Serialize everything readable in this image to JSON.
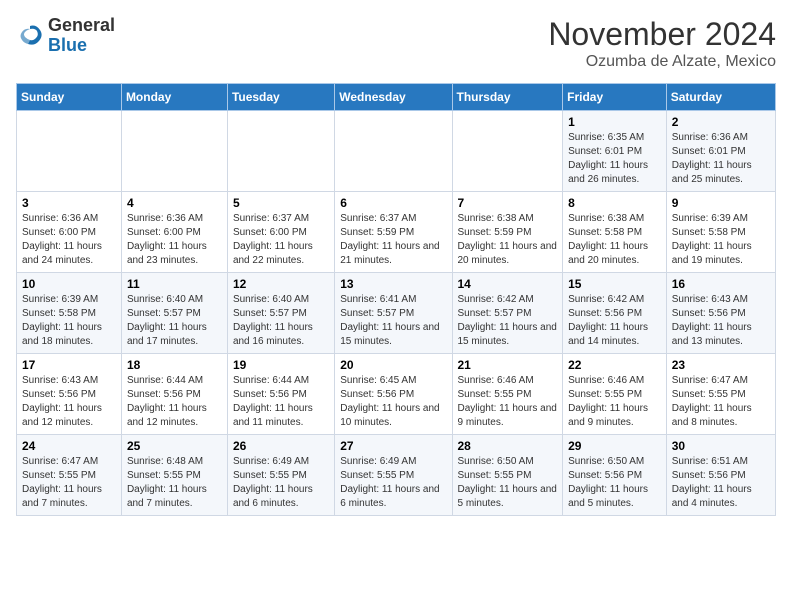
{
  "logo": {
    "general": "General",
    "blue": "Blue"
  },
  "title": "November 2024",
  "subtitle": "Ozumba de Alzate, Mexico",
  "headers": [
    "Sunday",
    "Monday",
    "Tuesday",
    "Wednesday",
    "Thursday",
    "Friday",
    "Saturday"
  ],
  "weeks": [
    [
      {
        "day": "",
        "info": ""
      },
      {
        "day": "",
        "info": ""
      },
      {
        "day": "",
        "info": ""
      },
      {
        "day": "",
        "info": ""
      },
      {
        "day": "",
        "info": ""
      },
      {
        "day": "1",
        "info": "Sunrise: 6:35 AM\nSunset: 6:01 PM\nDaylight: 11 hours and 26 minutes."
      },
      {
        "day": "2",
        "info": "Sunrise: 6:36 AM\nSunset: 6:01 PM\nDaylight: 11 hours and 25 minutes."
      }
    ],
    [
      {
        "day": "3",
        "info": "Sunrise: 6:36 AM\nSunset: 6:00 PM\nDaylight: 11 hours and 24 minutes."
      },
      {
        "day": "4",
        "info": "Sunrise: 6:36 AM\nSunset: 6:00 PM\nDaylight: 11 hours and 23 minutes."
      },
      {
        "day": "5",
        "info": "Sunrise: 6:37 AM\nSunset: 6:00 PM\nDaylight: 11 hours and 22 minutes."
      },
      {
        "day": "6",
        "info": "Sunrise: 6:37 AM\nSunset: 5:59 PM\nDaylight: 11 hours and 21 minutes."
      },
      {
        "day": "7",
        "info": "Sunrise: 6:38 AM\nSunset: 5:59 PM\nDaylight: 11 hours and 20 minutes."
      },
      {
        "day": "8",
        "info": "Sunrise: 6:38 AM\nSunset: 5:58 PM\nDaylight: 11 hours and 20 minutes."
      },
      {
        "day": "9",
        "info": "Sunrise: 6:39 AM\nSunset: 5:58 PM\nDaylight: 11 hours and 19 minutes."
      }
    ],
    [
      {
        "day": "10",
        "info": "Sunrise: 6:39 AM\nSunset: 5:58 PM\nDaylight: 11 hours and 18 minutes."
      },
      {
        "day": "11",
        "info": "Sunrise: 6:40 AM\nSunset: 5:57 PM\nDaylight: 11 hours and 17 minutes."
      },
      {
        "day": "12",
        "info": "Sunrise: 6:40 AM\nSunset: 5:57 PM\nDaylight: 11 hours and 16 minutes."
      },
      {
        "day": "13",
        "info": "Sunrise: 6:41 AM\nSunset: 5:57 PM\nDaylight: 11 hours and 15 minutes."
      },
      {
        "day": "14",
        "info": "Sunrise: 6:42 AM\nSunset: 5:57 PM\nDaylight: 11 hours and 15 minutes."
      },
      {
        "day": "15",
        "info": "Sunrise: 6:42 AM\nSunset: 5:56 PM\nDaylight: 11 hours and 14 minutes."
      },
      {
        "day": "16",
        "info": "Sunrise: 6:43 AM\nSunset: 5:56 PM\nDaylight: 11 hours and 13 minutes."
      }
    ],
    [
      {
        "day": "17",
        "info": "Sunrise: 6:43 AM\nSunset: 5:56 PM\nDaylight: 11 hours and 12 minutes."
      },
      {
        "day": "18",
        "info": "Sunrise: 6:44 AM\nSunset: 5:56 PM\nDaylight: 11 hours and 12 minutes."
      },
      {
        "day": "19",
        "info": "Sunrise: 6:44 AM\nSunset: 5:56 PM\nDaylight: 11 hours and 11 minutes."
      },
      {
        "day": "20",
        "info": "Sunrise: 6:45 AM\nSunset: 5:56 PM\nDaylight: 11 hours and 10 minutes."
      },
      {
        "day": "21",
        "info": "Sunrise: 6:46 AM\nSunset: 5:55 PM\nDaylight: 11 hours and 9 minutes."
      },
      {
        "day": "22",
        "info": "Sunrise: 6:46 AM\nSunset: 5:55 PM\nDaylight: 11 hours and 9 minutes."
      },
      {
        "day": "23",
        "info": "Sunrise: 6:47 AM\nSunset: 5:55 PM\nDaylight: 11 hours and 8 minutes."
      }
    ],
    [
      {
        "day": "24",
        "info": "Sunrise: 6:47 AM\nSunset: 5:55 PM\nDaylight: 11 hours and 7 minutes."
      },
      {
        "day": "25",
        "info": "Sunrise: 6:48 AM\nSunset: 5:55 PM\nDaylight: 11 hours and 7 minutes."
      },
      {
        "day": "26",
        "info": "Sunrise: 6:49 AM\nSunset: 5:55 PM\nDaylight: 11 hours and 6 minutes."
      },
      {
        "day": "27",
        "info": "Sunrise: 6:49 AM\nSunset: 5:55 PM\nDaylight: 11 hours and 6 minutes."
      },
      {
        "day": "28",
        "info": "Sunrise: 6:50 AM\nSunset: 5:55 PM\nDaylight: 11 hours and 5 minutes."
      },
      {
        "day": "29",
        "info": "Sunrise: 6:50 AM\nSunset: 5:56 PM\nDaylight: 11 hours and 5 minutes."
      },
      {
        "day": "30",
        "info": "Sunrise: 6:51 AM\nSunset: 5:56 PM\nDaylight: 11 hours and 4 minutes."
      }
    ]
  ]
}
